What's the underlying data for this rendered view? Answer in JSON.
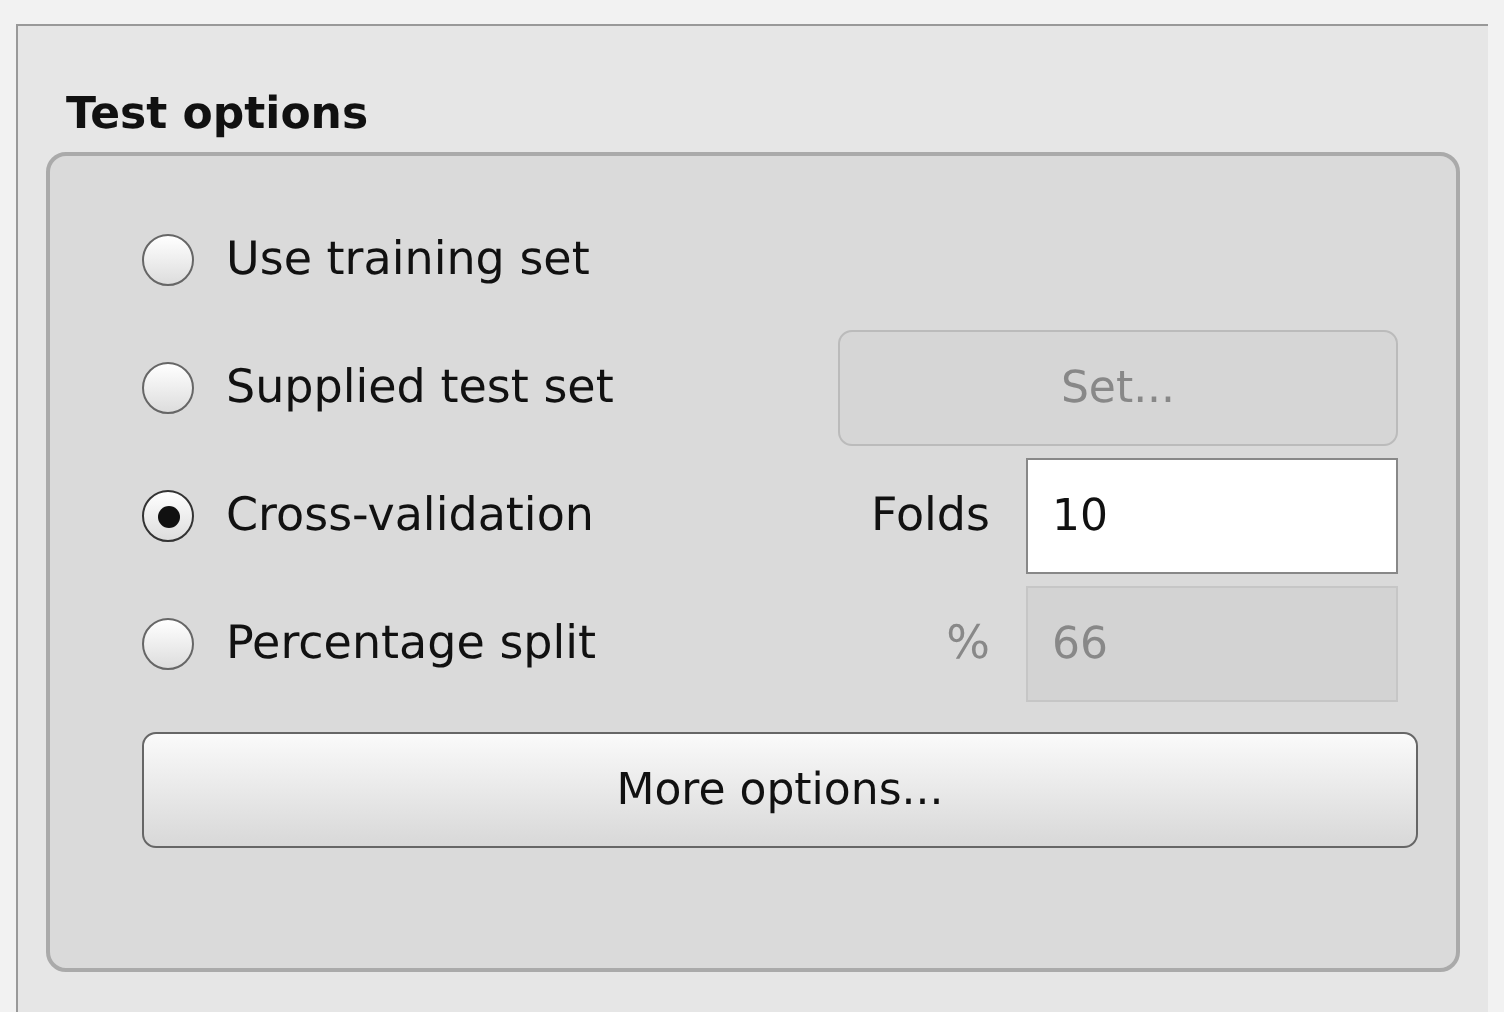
{
  "panel": {
    "title": "Test options"
  },
  "options": [
    {
      "label": "Use training set",
      "selected": false
    },
    {
      "label": "Supplied test set",
      "selected": false,
      "control": {
        "kind": "button",
        "label": "Set...",
        "disabled": true
      }
    },
    {
      "label": "Cross-validation",
      "selected": true,
      "control": {
        "kind": "field",
        "label": "Folds",
        "value": "10",
        "disabled": false
      }
    },
    {
      "label": "Percentage split",
      "selected": false,
      "control": {
        "kind": "field",
        "label": "%",
        "value": "66",
        "disabled": true
      }
    }
  ],
  "more_button": "More options..."
}
